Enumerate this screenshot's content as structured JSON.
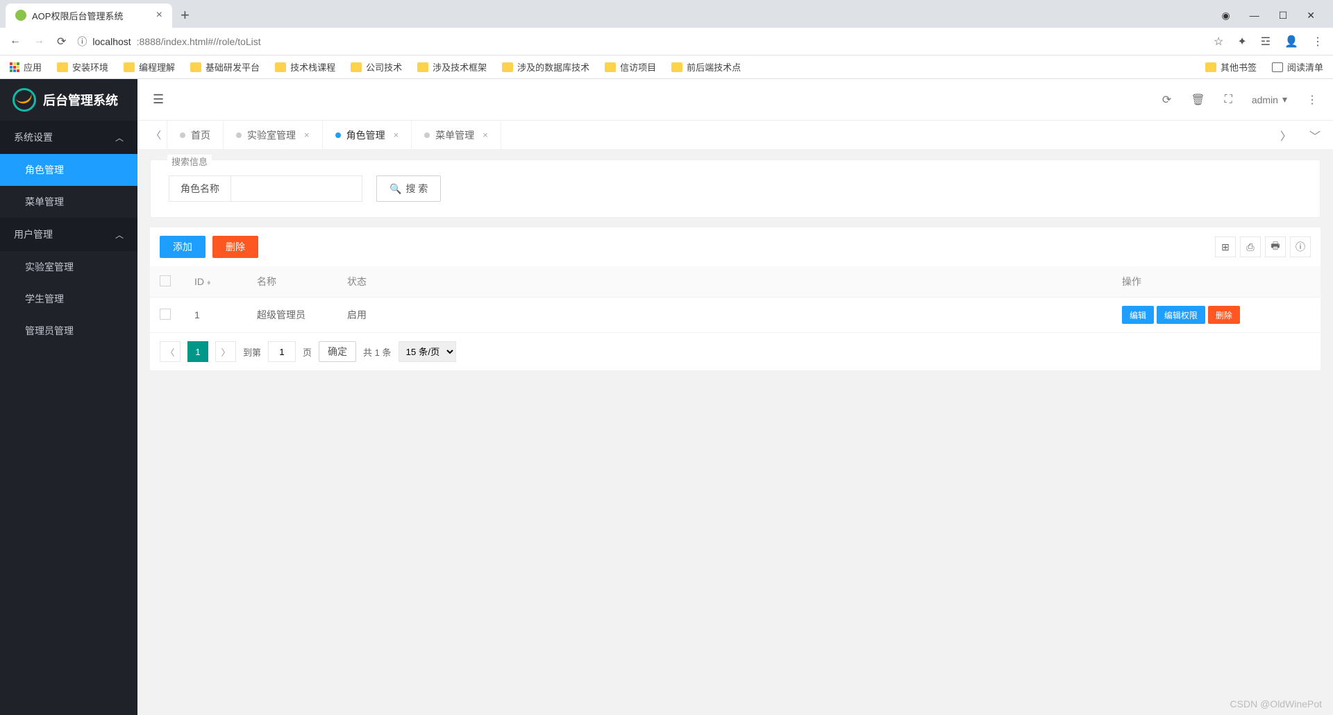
{
  "browser": {
    "tab_title": "AOP权限后台管理系统",
    "url_host": "localhost",
    "url_port_path": ":8888/index.html#//role/toList",
    "bookmarks": {
      "apps": "应用",
      "items": [
        "安装环境",
        "编程理解",
        "基础研发平台",
        "技术栈课程",
        "公司技术",
        "涉及技术框架",
        "涉及的数据库技术",
        "信访项目",
        "前后端技术点"
      ],
      "other": "其他书签",
      "reading": "阅读清单"
    }
  },
  "app": {
    "title": "后台管理系统",
    "user": "admin",
    "sidebar": {
      "group1": {
        "label": "系统设置",
        "items": [
          "角色管理",
          "菜单管理"
        ]
      },
      "group2": {
        "label": "用户管理",
        "items": [
          "实验室管理",
          "学生管理",
          "管理员管理"
        ]
      }
    },
    "tabs": [
      "首页",
      "实验室管理",
      "角色管理",
      "菜单管理"
    ],
    "search": {
      "legend": "搜索信息",
      "field_label": "角色名称",
      "btn": "搜 索"
    },
    "toolbar": {
      "add": "添加",
      "del": "删除"
    },
    "table": {
      "headers": {
        "id": "ID",
        "name": "名称",
        "status": "状态",
        "ops": "操作"
      },
      "rows": [
        {
          "id": "1",
          "name": "超级管理员",
          "status": "启用"
        }
      ],
      "ops": {
        "edit": "编辑",
        "edit_perm": "编辑权限",
        "del": "删除"
      }
    },
    "pager": {
      "current": "1",
      "goto_prefix": "到第",
      "goto_value": "1",
      "goto_suffix": "页",
      "confirm": "确定",
      "total": "共 1 条",
      "per_page": "15 条/页"
    }
  },
  "watermark": "CSDN @OldWinePot"
}
